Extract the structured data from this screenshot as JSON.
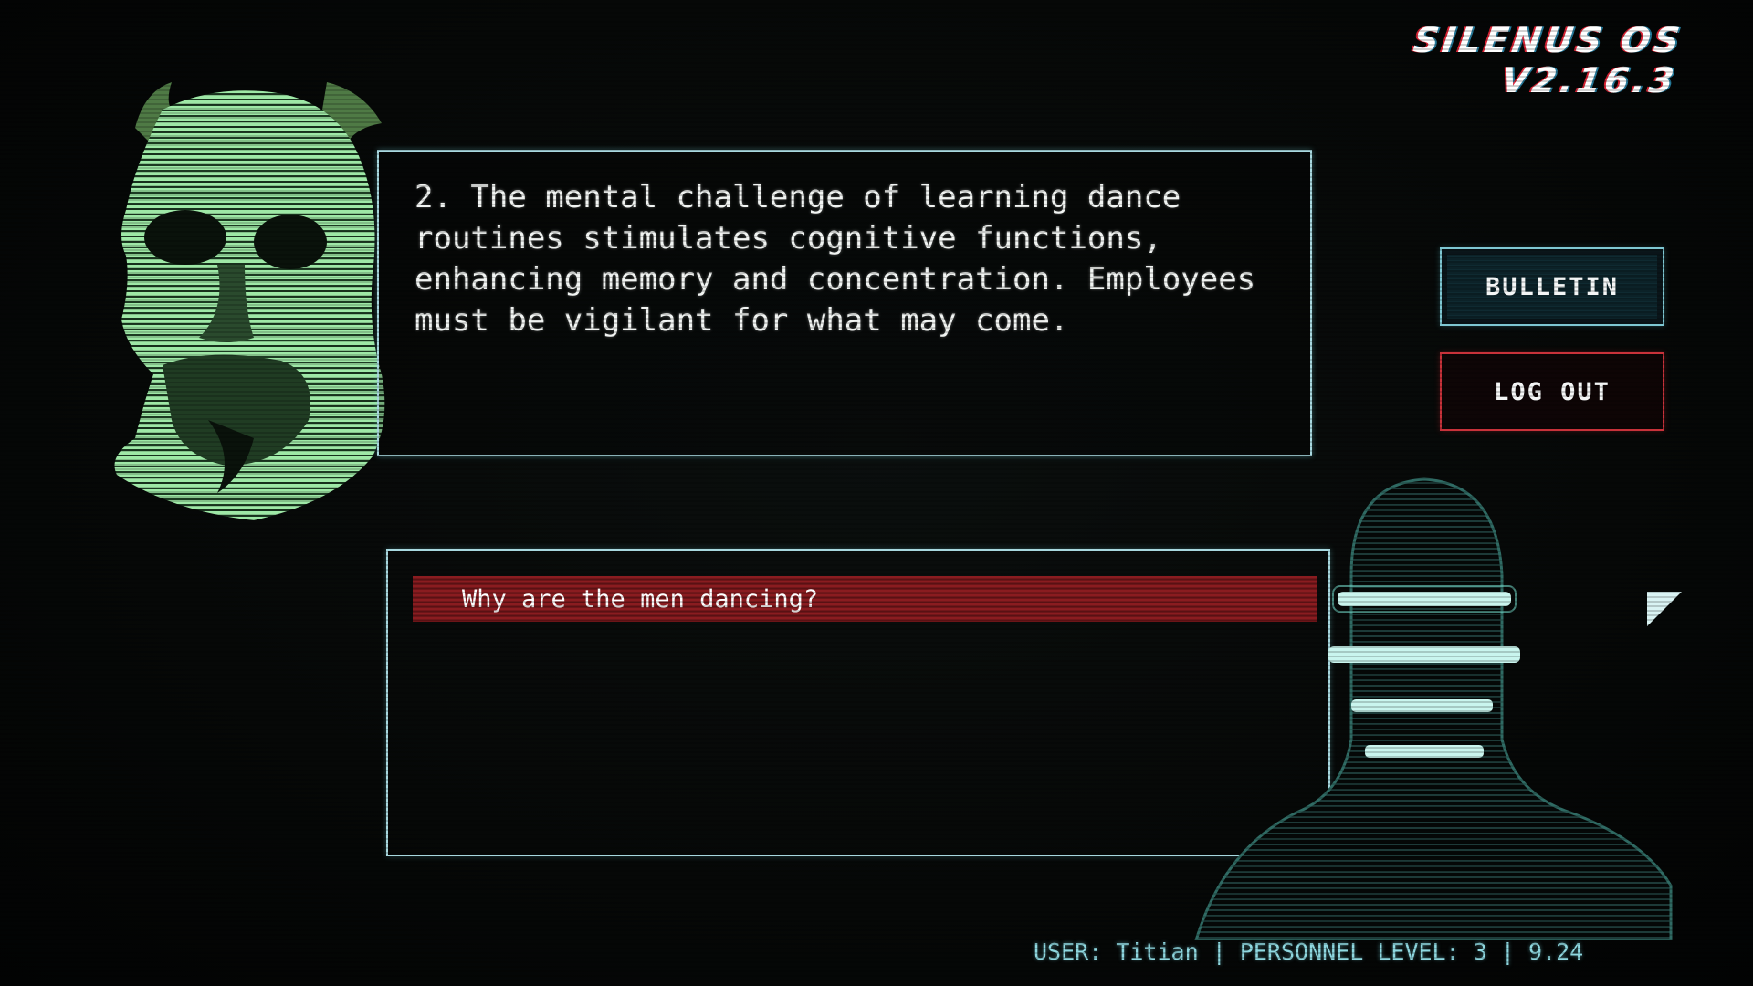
{
  "header": {
    "os_title": "SILENUS OS V2.16.3"
  },
  "dialogue": {
    "text": "2. The mental challenge of learning dance routines stimulates cognitive functions, enhancing memory and concentration. Employees must be vigilant for what may come."
  },
  "side_menu": {
    "bulletin_label": "BULLETIN",
    "logout_label": "LOG OUT"
  },
  "responses": {
    "options": [
      {
        "label": "Why are the men dancing?"
      }
    ]
  },
  "status_bar": {
    "user_label": "USER:",
    "user_name": "Titian",
    "separator": "|",
    "level_label": "PERSONNEL LEVEL:",
    "level_value": "3",
    "version_value": "9.24"
  },
  "icons": {
    "statue": "statue-bust-icon",
    "figure": "hooded-figure-icon",
    "cursor": "cursor-arrow-icon"
  },
  "colors": {
    "statue_green": "#8fe39a",
    "frame_cyan": "#a8d8df",
    "accent_red": "#8a1c20",
    "logout_red": "#c8323a",
    "status_cyan": "#8fd8e0"
  }
}
